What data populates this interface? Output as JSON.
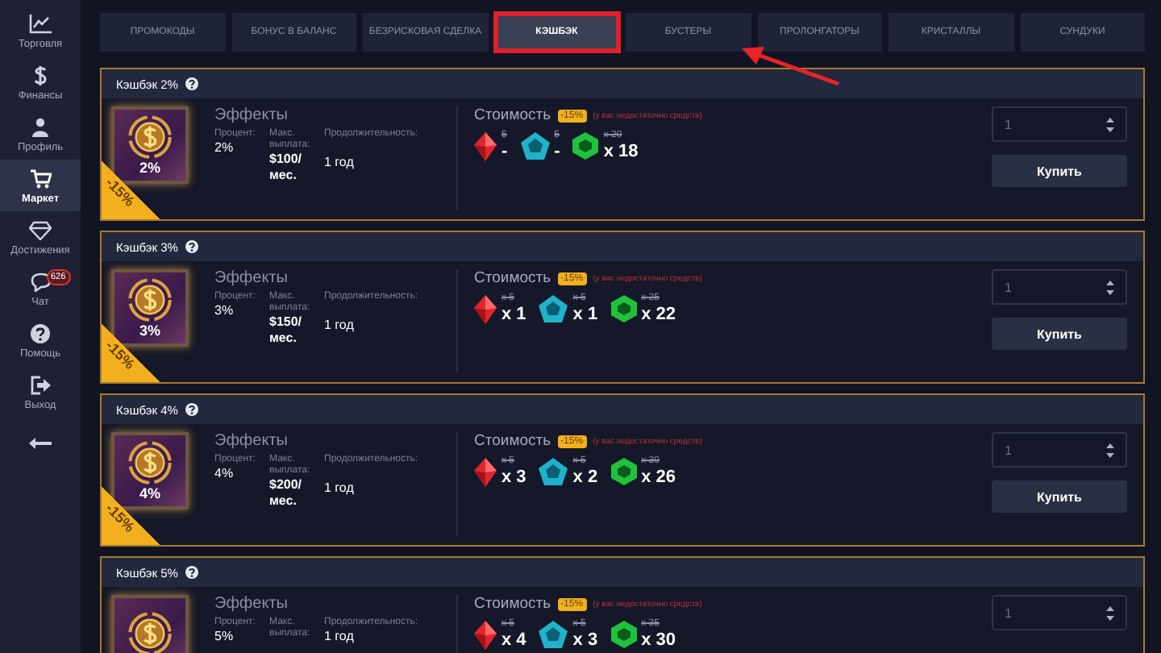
{
  "sidebar": {
    "items": [
      {
        "kind": "chart",
        "label": "Торговля",
        "selected": false
      },
      {
        "kind": "dollar",
        "label": "Финансы",
        "selected": false
      },
      {
        "kind": "person",
        "label": "Профиль",
        "selected": false
      },
      {
        "kind": "cart",
        "label": "Маркет",
        "selected": true
      },
      {
        "kind": "diamond",
        "label": "Достижения",
        "selected": false
      },
      {
        "kind": "chat",
        "label": "Чат",
        "badge": "626",
        "selected": false
      },
      {
        "kind": "help",
        "label": "Помощь",
        "selected": false
      },
      {
        "kind": "exit",
        "label": "Выход",
        "selected": false
      },
      {
        "kind": "collapse",
        "selected": false
      }
    ]
  },
  "tabs": [
    {
      "label": "ПРОМОКОДЫ",
      "selected": false
    },
    {
      "label": "БОНУС В БАЛАНС",
      "selected": false
    },
    {
      "label": "БЕЗРИСКОВАЯ СДЕЛКА",
      "selected": false
    },
    {
      "label": "КЭШБЭК",
      "selected": true
    },
    {
      "label": "БУСТЕРЫ",
      "selected": false
    },
    {
      "label": "ПРОЛОНГАТОРЫ",
      "selected": false
    },
    {
      "label": "КРИСТАЛЛЫ",
      "selected": false
    },
    {
      "label": "СУНДУКИ",
      "selected": false
    }
  ],
  "cards": [
    {
      "title": "Кэшбэк 2%",
      "image_label": "2%",
      "ribbon": "-15%",
      "effects_heading": "Эффекты",
      "stats": [
        {
          "label": "Процент:",
          "value": "2%"
        },
        {
          "label": "Макс. выплата:",
          "value": "$100/ мес."
        },
        {
          "label": "Продолжительность:",
          "value": "1 год"
        }
      ],
      "cost_heading": "Стоимость",
      "discount": "-15%",
      "warning": "(у вас недостаточно средств)",
      "costs": [
        {
          "kind": "ruby",
          "old": "5",
          "new": "-"
        },
        {
          "kind": "sapphire",
          "old": "5",
          "new": "-"
        },
        {
          "kind": "emerald",
          "old": "x 20",
          "new": "x 18"
        }
      ],
      "quantity": "1",
      "buy": "Купить"
    },
    {
      "title": "Кэшбэк 3%",
      "image_label": "3%",
      "ribbon": "-15%",
      "effects_heading": "Эффекты",
      "stats": [
        {
          "label": "Процент:",
          "value": "3%"
        },
        {
          "label": "Макс. выплата:",
          "value": "$150/ мес."
        },
        {
          "label": "Продолжительность:",
          "value": "1 год"
        }
      ],
      "cost_heading": "Стоимость",
      "discount": "-15%",
      "warning": "(у вас недостаточно средств)",
      "costs": [
        {
          "kind": "ruby",
          "old": "x 5",
          "new": "x 1"
        },
        {
          "kind": "sapphire",
          "old": "x 5",
          "new": "x 1"
        },
        {
          "kind": "emerald",
          "old": "x 25",
          "new": "x 22"
        }
      ],
      "quantity": "1",
      "buy": "Купить"
    },
    {
      "title": "Кэшбэк 4%",
      "image_label": "4%",
      "ribbon": "-15%",
      "effects_heading": "Эффекты",
      "stats": [
        {
          "label": "Процент:",
          "value": "4%"
        },
        {
          "label": "Макс. выплата:",
          "value": "$200/ мес."
        },
        {
          "label": "Продолжительность:",
          "value": "1 год"
        }
      ],
      "cost_heading": "Стоимость",
      "discount": "-15%",
      "warning": "(у вас недостаточно средств)",
      "costs": [
        {
          "kind": "ruby",
          "old": "x 5",
          "new": "x 3"
        },
        {
          "kind": "sapphire",
          "old": "x 5",
          "new": "x 2"
        },
        {
          "kind": "emerald",
          "old": "x 30",
          "new": "x 26"
        }
      ],
      "quantity": "1",
      "buy": "Купить"
    },
    {
      "title": "Кэшбэк 5%",
      "effects_heading": "Эффекты",
      "stats": [
        {
          "label": "Процент:",
          "value": "5%"
        },
        {
          "label": "Макс. выплата:"
        },
        {
          "label": "Продолжительность:",
          "value": "1 год"
        }
      ],
      "cost_heading": "Стоимость",
      "discount": "-15%",
      "warning": "(у вас недостаточно средств)",
      "costs": [
        {
          "kind": "ruby",
          "old": "x 5",
          "new": "x 4"
        },
        {
          "kind": "sapphire",
          "old": "x 5",
          "new": "x 3"
        },
        {
          "kind": "emerald",
          "old": "x 35",
          "new": "x 30"
        }
      ],
      "quantity": "1"
    }
  ]
}
